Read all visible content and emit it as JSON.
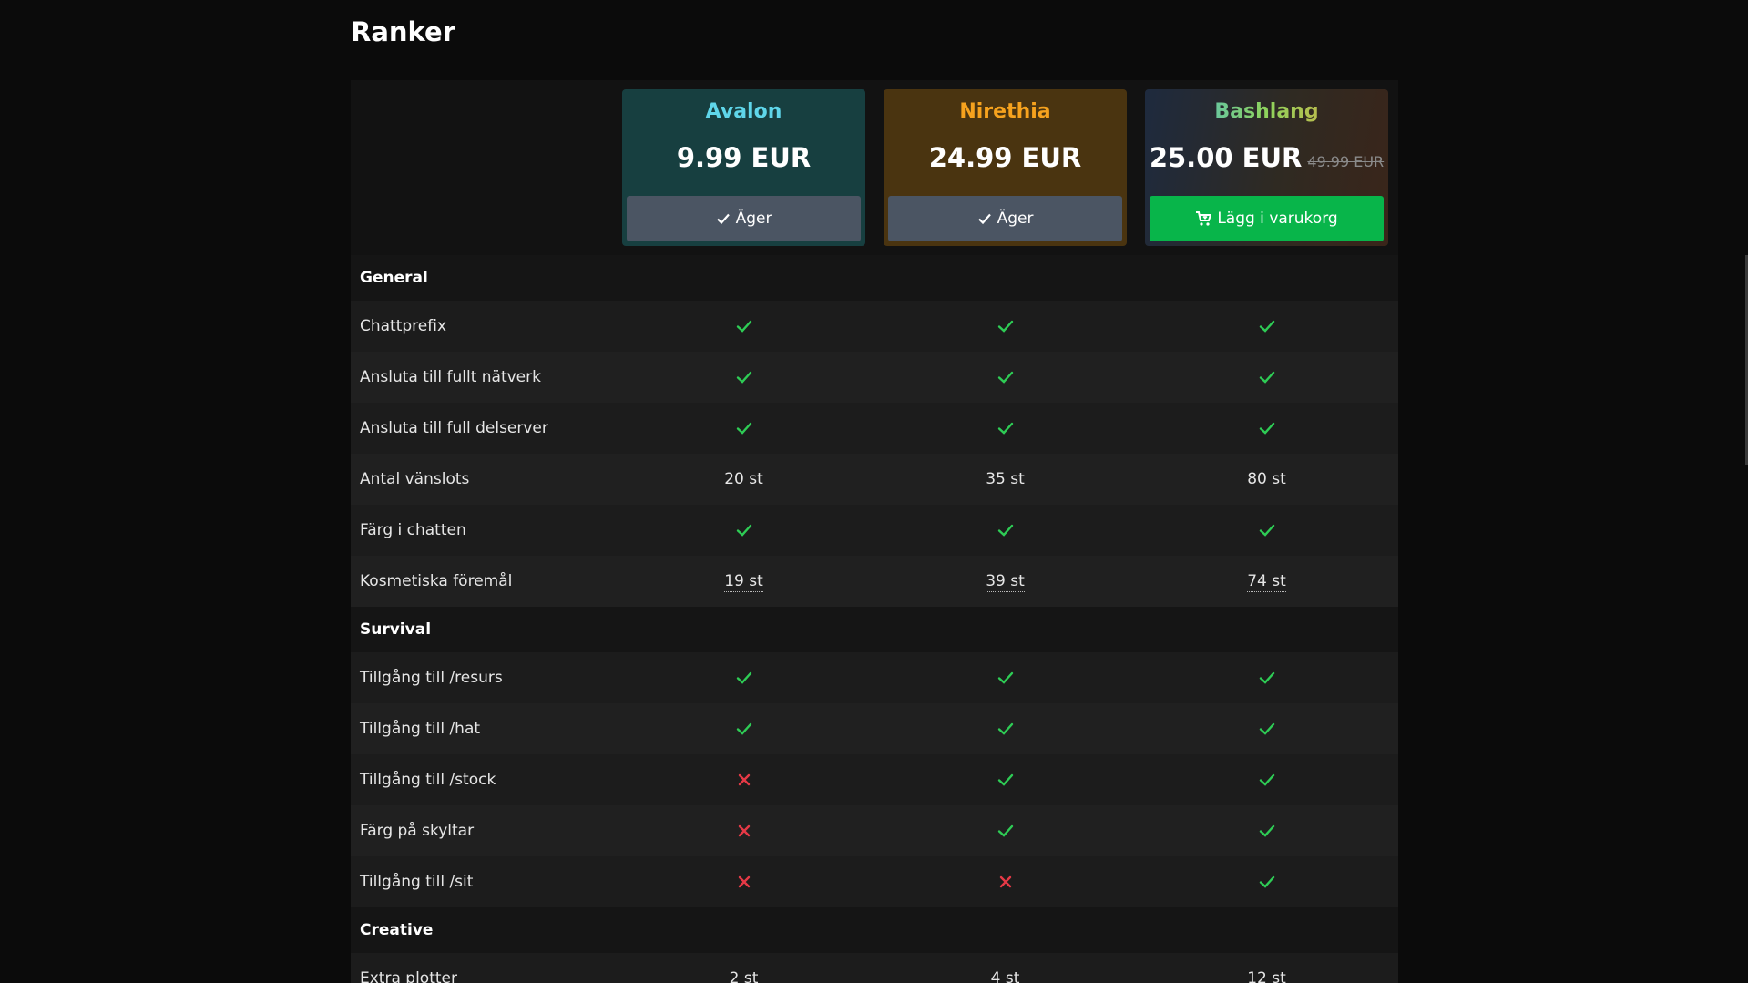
{
  "page": {
    "title": "Ranker"
  },
  "colors": {
    "check": "#2ecc55",
    "cross": "#e53946",
    "buy": "#08b54a",
    "owned": "#4b5563"
  },
  "ranks": [
    {
      "name": "Avalon",
      "price": "9.99 EUR",
      "button": "Äger",
      "button_icon": "check-icon"
    },
    {
      "name": "Nirethia",
      "price": "24.99 EUR",
      "button": "Äger",
      "button_icon": "check-icon"
    },
    {
      "name": "Bashlang",
      "price": "25.00 EUR",
      "old_price": "49.99 EUR",
      "button": "Lägg i varukorg",
      "button_icon": "cart-icon"
    }
  ],
  "sections": [
    {
      "title": "General",
      "rows": [
        {
          "label": "Chattprefix",
          "values": [
            "check",
            "check",
            "check"
          ]
        },
        {
          "label": "Ansluta till fullt nätverk",
          "values": [
            "check",
            "check",
            "check"
          ]
        },
        {
          "label": "Ansluta till full delserver",
          "values": [
            "check",
            "check",
            "check"
          ]
        },
        {
          "label": "Antal vänslots",
          "values": [
            "20 st",
            "35 st",
            "80 st"
          ]
        },
        {
          "label": "Färg i chatten",
          "values": [
            "check",
            "check",
            "check"
          ]
        },
        {
          "label": "Kosmetiska föremål",
          "values": [
            "19 st",
            "39 st",
            "74 st"
          ],
          "dotted": true
        }
      ]
    },
    {
      "title": "Survival",
      "rows": [
        {
          "label": "Tillgång till /resurs",
          "values": [
            "check",
            "check",
            "check"
          ]
        },
        {
          "label": "Tillgång till /hat",
          "values": [
            "check",
            "check",
            "check"
          ]
        },
        {
          "label": "Tillgång till /stock",
          "values": [
            "cross",
            "check",
            "check"
          ]
        },
        {
          "label": "Färg på skyltar",
          "values": [
            "cross",
            "check",
            "check"
          ]
        },
        {
          "label": "Tillgång till /sit",
          "values": [
            "cross",
            "cross",
            "check"
          ]
        }
      ]
    },
    {
      "title": "Creative",
      "rows": [
        {
          "label": "Extra plotter",
          "values": [
            "2 st",
            "4 st",
            "12 st"
          ]
        }
      ]
    }
  ]
}
